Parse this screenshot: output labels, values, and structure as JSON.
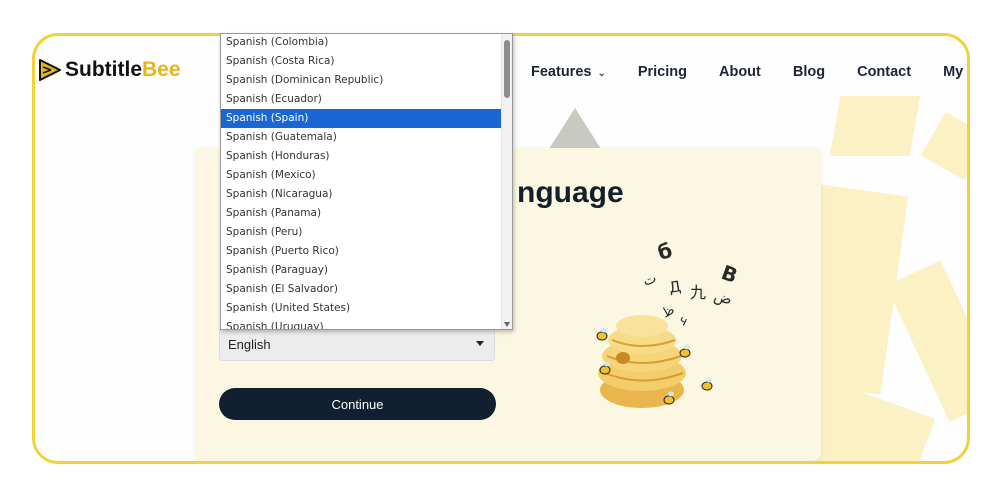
{
  "header": {
    "logo": {
      "part1": "Subtitle",
      "part2": "Bee"
    },
    "nav": [
      {
        "label": "Features",
        "has_dropdown": true
      },
      {
        "label": "Pricing"
      },
      {
        "label": "About"
      },
      {
        "label": "Blog"
      },
      {
        "label": "Contact"
      },
      {
        "label": "My Files"
      }
    ]
  },
  "card": {
    "title_fragment": "nguage",
    "language_select": {
      "value": "English"
    },
    "continue_label": "Continue"
  },
  "dropdown": {
    "items": [
      "Spanish (Colombia)",
      "Spanish (Costa Rica)",
      "Spanish (Dominican Republic)",
      "Spanish (Ecuador)",
      "Spanish (Spain)",
      "Spanish (Guatemala)",
      "Spanish (Honduras)",
      "Spanish (Mexico)",
      "Spanish (Nicaragua)",
      "Spanish (Panama)",
      "Spanish (Peru)",
      "Spanish (Puerto Rico)",
      "Spanish (Paraguay)",
      "Spanish (El Salvador)",
      "Spanish (United States)",
      "Spanish (Uruguay)"
    ],
    "selected": "Spanish (Spain)"
  },
  "colors": {
    "frame_border": "#f2d23b",
    "brand_yellow": "#e7b519",
    "selection_blue": "#1a67d3",
    "button_dark": "#102030",
    "card_bg": "#fbf7e3"
  },
  "icons": {
    "logo": "play-arrow-logo-icon",
    "nav_chevron": "chevron-down-icon",
    "select_caret": "caret-down-icon"
  }
}
